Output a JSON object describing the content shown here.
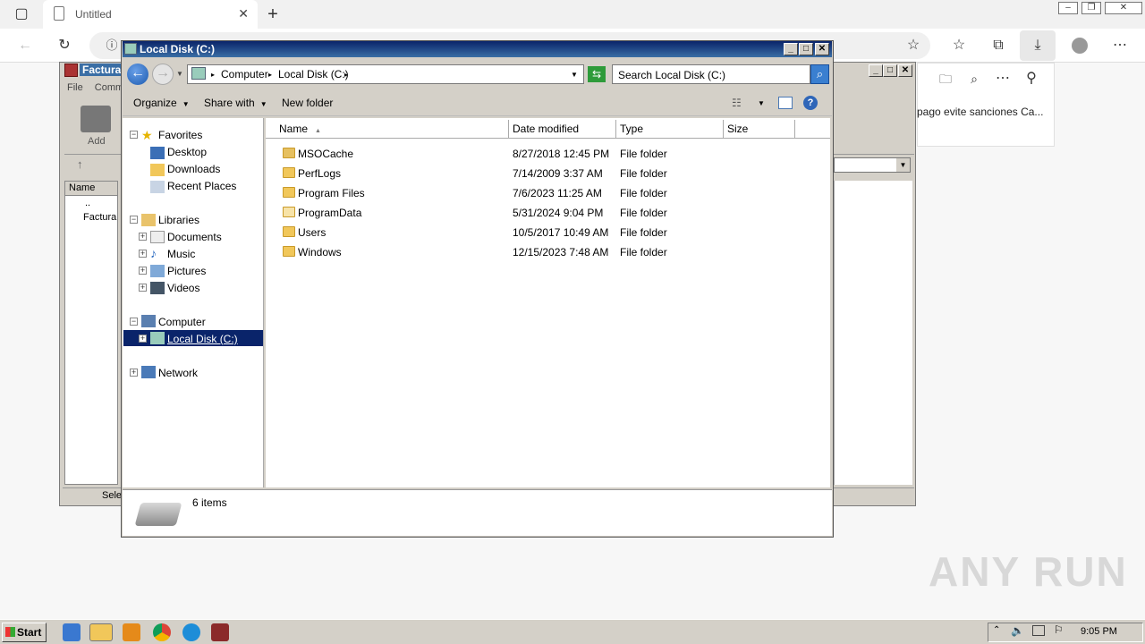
{
  "browser": {
    "tab_title": "Untitled",
    "side_panel_text": "pago evite sanciones Ca..."
  },
  "rar_window": {
    "title": "Factura",
    "menu_file": "File",
    "menu_commands": "Comm",
    "add_label": "Add",
    "list_header": "Name",
    "list_items": [
      "..",
      "Factura"
    ],
    "status": "Sele"
  },
  "explorer": {
    "title": "Local Disk (C:)",
    "breadcrumb": [
      "Computer",
      "Local Disk (C:)"
    ],
    "search_placeholder": "Search Local Disk (C:)",
    "commands": {
      "organize": "Organize",
      "share_with": "Share with",
      "new_folder": "New folder"
    },
    "nav": {
      "favorites": "Favorites",
      "desktop": "Desktop",
      "downloads": "Downloads",
      "recent_places": "Recent Places",
      "libraries": "Libraries",
      "documents": "Documents",
      "music": "Music",
      "pictures": "Pictures",
      "videos": "Videos",
      "computer": "Computer",
      "local_disk": "Local Disk (C:)",
      "network": "Network"
    },
    "columns": {
      "name": "Name",
      "date_modified": "Date modified",
      "type": "Type",
      "size": "Size"
    },
    "files": [
      {
        "name": "MSOCache",
        "date": "8/27/2018 12:45 PM",
        "type": "File folder"
      },
      {
        "name": "PerfLogs",
        "date": "7/14/2009 3:37 AM",
        "type": "File folder"
      },
      {
        "name": "Program Files",
        "date": "7/6/2023 11:25 AM",
        "type": "File folder"
      },
      {
        "name": "ProgramData",
        "date": "5/31/2024 9:04 PM",
        "type": "File folder"
      },
      {
        "name": "Users",
        "date": "10/5/2017 10:49 AM",
        "type": "File folder"
      },
      {
        "name": "Windows",
        "date": "12/15/2023 7:48 AM",
        "type": "File folder"
      }
    ],
    "item_count": "6 items"
  },
  "taskbar": {
    "start_label": "Start",
    "clock": "9:05 PM"
  },
  "watermark": "ANY RUN"
}
